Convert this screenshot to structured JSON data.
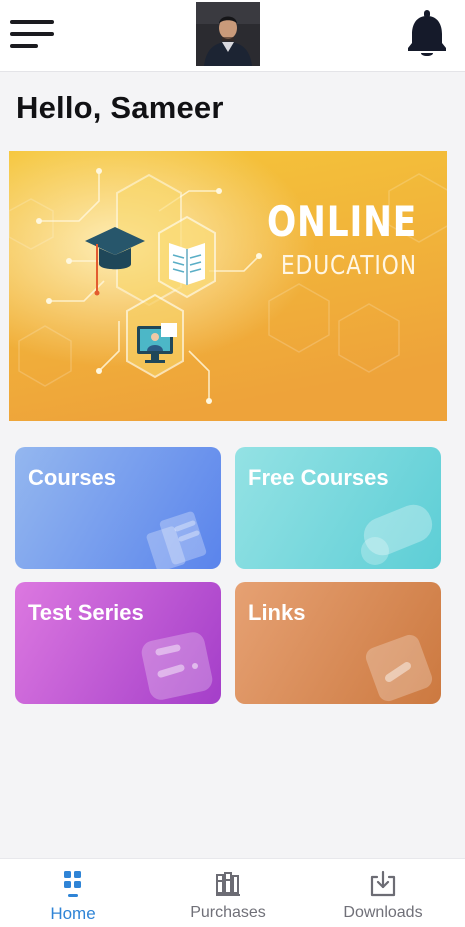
{
  "header": {
    "greeting": "Hello, Sameer",
    "menu_icon": "hamburger-menu-icon",
    "bell_icon": "bell-icon"
  },
  "banner": {
    "title": "ONLINE",
    "subtitle": "EDUCATION",
    "colors": {
      "top": "#f4c338",
      "bottom": "#eea53a"
    }
  },
  "cards": [
    {
      "label": "Courses",
      "colors": [
        "#8fb3ee",
        "#5a85ec"
      ]
    },
    {
      "label": "Free Courses",
      "colors": [
        "#8fe0e2",
        "#5bcfd6"
      ]
    },
    {
      "label": "Test Series",
      "colors": [
        "#d66fdc",
        "#a63fc9"
      ]
    },
    {
      "label": "Links",
      "colors": [
        "#e5a071",
        "#cc7a3f"
      ]
    }
  ],
  "bottom_nav": {
    "items": [
      {
        "label": "Home",
        "icon": "home-grid-icon",
        "active": true
      },
      {
        "label": "Purchases",
        "icon": "books-icon",
        "active": false
      },
      {
        "label": "Downloads",
        "icon": "download-icon",
        "active": false
      }
    ],
    "active_color": "#2f84d6"
  }
}
